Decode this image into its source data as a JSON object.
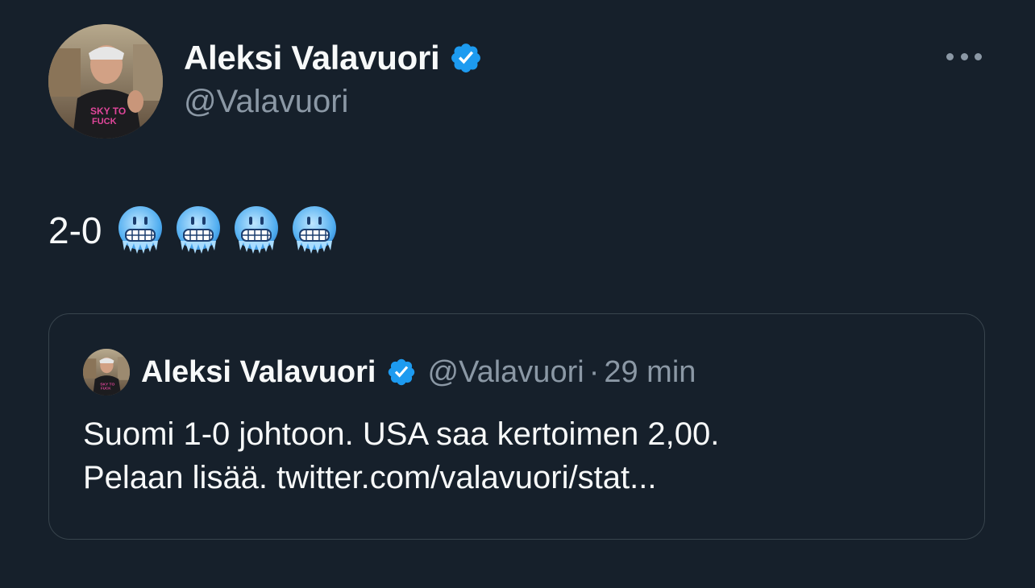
{
  "author": {
    "display_name": "Aleksi Valavuori",
    "handle": "@Valavuori",
    "verified": true,
    "avatar_icon": "profile-photo"
  },
  "more_icon": "more-horizontal-icon",
  "tweet": {
    "text": "2-0",
    "emojis": [
      "cold-face-emoji",
      "cold-face-emoji",
      "cold-face-emoji",
      "cold-face-emoji"
    ]
  },
  "quoted_tweet": {
    "display_name": "Aleksi Valavuori",
    "handle": "@Valavuori",
    "separator": "·",
    "time": "29 min",
    "verified": true,
    "text_line_1": "Suomi 1-0 johtoon. USA saa kertoimen 2,00.",
    "text_line_2": "Pelaan lisää. twitter.com/valavuori/stat..."
  },
  "colors": {
    "background": "#16202b",
    "text_primary": "#f7f9f9",
    "text_secondary": "#8b98a5",
    "verified_blue": "#1d9bf0",
    "border": "#38444d"
  }
}
